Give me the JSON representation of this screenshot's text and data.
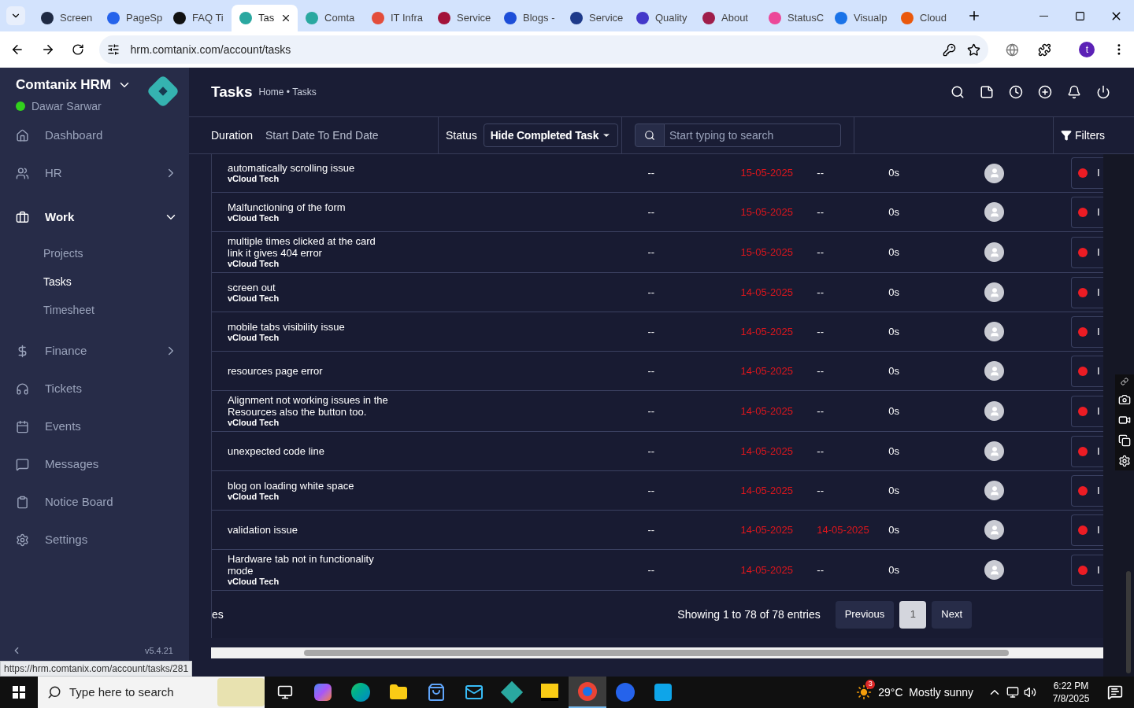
{
  "browser": {
    "tabs": [
      {
        "title": "Screen",
        "color": "#1f2a44",
        "selected": false
      },
      {
        "title": "PageSp",
        "color": "#2563eb",
        "selected": false
      },
      {
        "title": "FAQ Ti",
        "color": "#111111",
        "selected": false
      },
      {
        "title": "Tas",
        "color": "#2aa8a0",
        "selected": true
      },
      {
        "title": "Comta",
        "color": "#2aa8a0",
        "selected": false
      },
      {
        "title": "IT Infra",
        "color": "#e34d3b",
        "selected": false
      },
      {
        "title": "Service",
        "color": "#a3123a",
        "selected": false
      },
      {
        "title": "Blogs -",
        "color": "#1d4ed8",
        "selected": false
      },
      {
        "title": "Service",
        "color": "#1e3a8a",
        "selected": false
      },
      {
        "title": "Quality",
        "color": "#4338ca",
        "selected": false
      },
      {
        "title": "About",
        "color": "#9f1d4a",
        "selected": false
      },
      {
        "title": "StatusC",
        "color": "#ec4899",
        "selected": false
      },
      {
        "title": "Visualp",
        "color": "#1a73e8",
        "selected": false
      },
      {
        "title": "Cloud",
        "color": "#ea580c",
        "selected": false
      }
    ],
    "url": "hrm.comtanix.com/account/tasks",
    "profile": "t",
    "hover_link": "https://hrm.comtanix.com/account/tasks/281"
  },
  "sidebar": {
    "app_name": "Comtanix HRM",
    "user": "Dawar Sarwar",
    "items": [
      {
        "label": "Dashboard",
        "kind": "dashboard"
      },
      {
        "label": "HR",
        "kind": "hr",
        "expanded": false
      },
      {
        "label": "Work",
        "kind": "work",
        "expanded": true,
        "children": [
          {
            "label": "Projects",
            "selected": false
          },
          {
            "label": "Tasks",
            "selected": true
          },
          {
            "label": "Timesheet",
            "selected": false
          }
        ]
      },
      {
        "label": "Finance",
        "kind": "finance",
        "expanded": false
      },
      {
        "label": "Tickets",
        "kind": "tickets"
      },
      {
        "label": "Events",
        "kind": "events"
      },
      {
        "label": "Messages",
        "kind": "messages"
      },
      {
        "label": "Notice Board",
        "kind": "notice"
      },
      {
        "label": "Settings",
        "kind": "settings"
      }
    ],
    "version": "v5.4.21"
  },
  "header": {
    "title": "Tasks",
    "breadcrumb": "Home • Tasks"
  },
  "filters": {
    "duration_label": "Duration",
    "duration_value": "Start Date To End Date",
    "status_label": "Status",
    "status_value": "Hide Completed Task",
    "search_placeholder": "Start typing to search",
    "filters_button": "Filters"
  },
  "table": {
    "rows": [
      {
        "task": "automatically scrolling issue",
        "project": "vCloud Tech",
        "column_2": "--",
        "start_date": "15-05-2025",
        "due_date": "--",
        "hours": "0s",
        "status": "I"
      },
      {
        "task": "Malfunctioning of the form",
        "project": "vCloud Tech",
        "column_2": "--",
        "start_date": "15-05-2025",
        "due_date": "--",
        "hours": "0s",
        "status": "I"
      },
      {
        "task": "multiple times clicked at the card link it gives 404 error",
        "project": "vCloud Tech",
        "column_2": "--",
        "start_date": "15-05-2025",
        "due_date": "--",
        "hours": "0s",
        "status": "I"
      },
      {
        "task": "screen out",
        "project": "vCloud Tech",
        "column_2": "--",
        "start_date": "14-05-2025",
        "due_date": "--",
        "hours": "0s",
        "status": "I"
      },
      {
        "task": "mobile tabs visibility issue",
        "project": "vCloud Tech",
        "column_2": "--",
        "start_date": "14-05-2025",
        "due_date": "--",
        "hours": "0s",
        "status": "I"
      },
      {
        "task": "resources page error",
        "column_2": "--",
        "start_date": "14-05-2025",
        "due_date": "--",
        "hours": "0s",
        "status": "I"
      },
      {
        "task": "Alignment not working issues in the Resources also the button too.",
        "project": "vCloud Tech",
        "column_2": "--",
        "start_date": "14-05-2025",
        "due_date": "--",
        "hours": "0s",
        "status": "I"
      },
      {
        "task": "unexpected code line",
        "column_2": "--",
        "start_date": "14-05-2025",
        "due_date": "--",
        "hours": "0s",
        "status": "I"
      },
      {
        "task": "blog on loading white space",
        "project": "vCloud Tech",
        "column_2": "--",
        "start_date": "14-05-2025",
        "due_date": "--",
        "hours": "0s",
        "status": "I"
      },
      {
        "task": "validation issue",
        "column_2": "--",
        "start_date": "14-05-2025",
        "due_date": "14-05-2025",
        "hours": "0s",
        "status": "I"
      },
      {
        "task": "Hardware tab not in functionality mode",
        "project": "vCloud Tech",
        "column_2": "--",
        "start_date": "14-05-2025",
        "due_date": "--",
        "hours": "0s",
        "status": "I"
      }
    ],
    "footer_left": "es",
    "summary": "Showing 1 to 78 of 78 entries",
    "pagination": [
      {
        "label": "Previous",
        "selected": false
      },
      {
        "label": "1",
        "selected": true
      },
      {
        "label": "Next",
        "selected": false
      }
    ]
  },
  "taskbar": {
    "search_placeholder": "Type here to search",
    "apps": [
      {
        "kind": "task-view",
        "selected": false
      },
      {
        "kind": "copilot",
        "selected": false
      },
      {
        "kind": "edge",
        "selected": false
      },
      {
        "kind": "folder",
        "selected": false
      },
      {
        "kind": "store",
        "selected": false
      },
      {
        "kind": "mail",
        "selected": false
      },
      {
        "kind": "app",
        "selected": false
      },
      {
        "kind": "sticky",
        "selected": false
      },
      {
        "kind": "chrome",
        "selected": true
      },
      {
        "kind": "zoom",
        "selected": false
      },
      {
        "kind": "media",
        "selected": false
      }
    ],
    "weather_badge": "3",
    "weather": "29°C  Mostly sunny",
    "time": "6:22 PM",
    "date": "7/8/2025"
  }
}
